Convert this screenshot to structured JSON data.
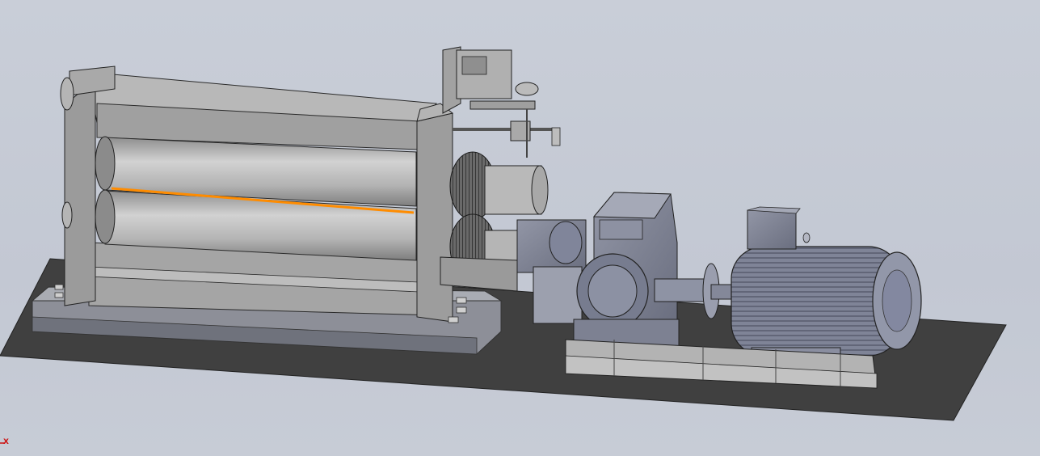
{
  "viewport": {
    "background": "#c6cbd6",
    "triad_label": "X",
    "triad_color": "#cc1111"
  },
  "colors": {
    "floor_plate": "#3d3d3d",
    "frame_gray": "#a7a7a7",
    "roller_gray": "#b9b9b9",
    "motor_blue_gray": "#8a8fa0",
    "highlight_edge": "#ff8c00"
  },
  "icons": {
    "triad": "coordinate-triad-icon"
  }
}
